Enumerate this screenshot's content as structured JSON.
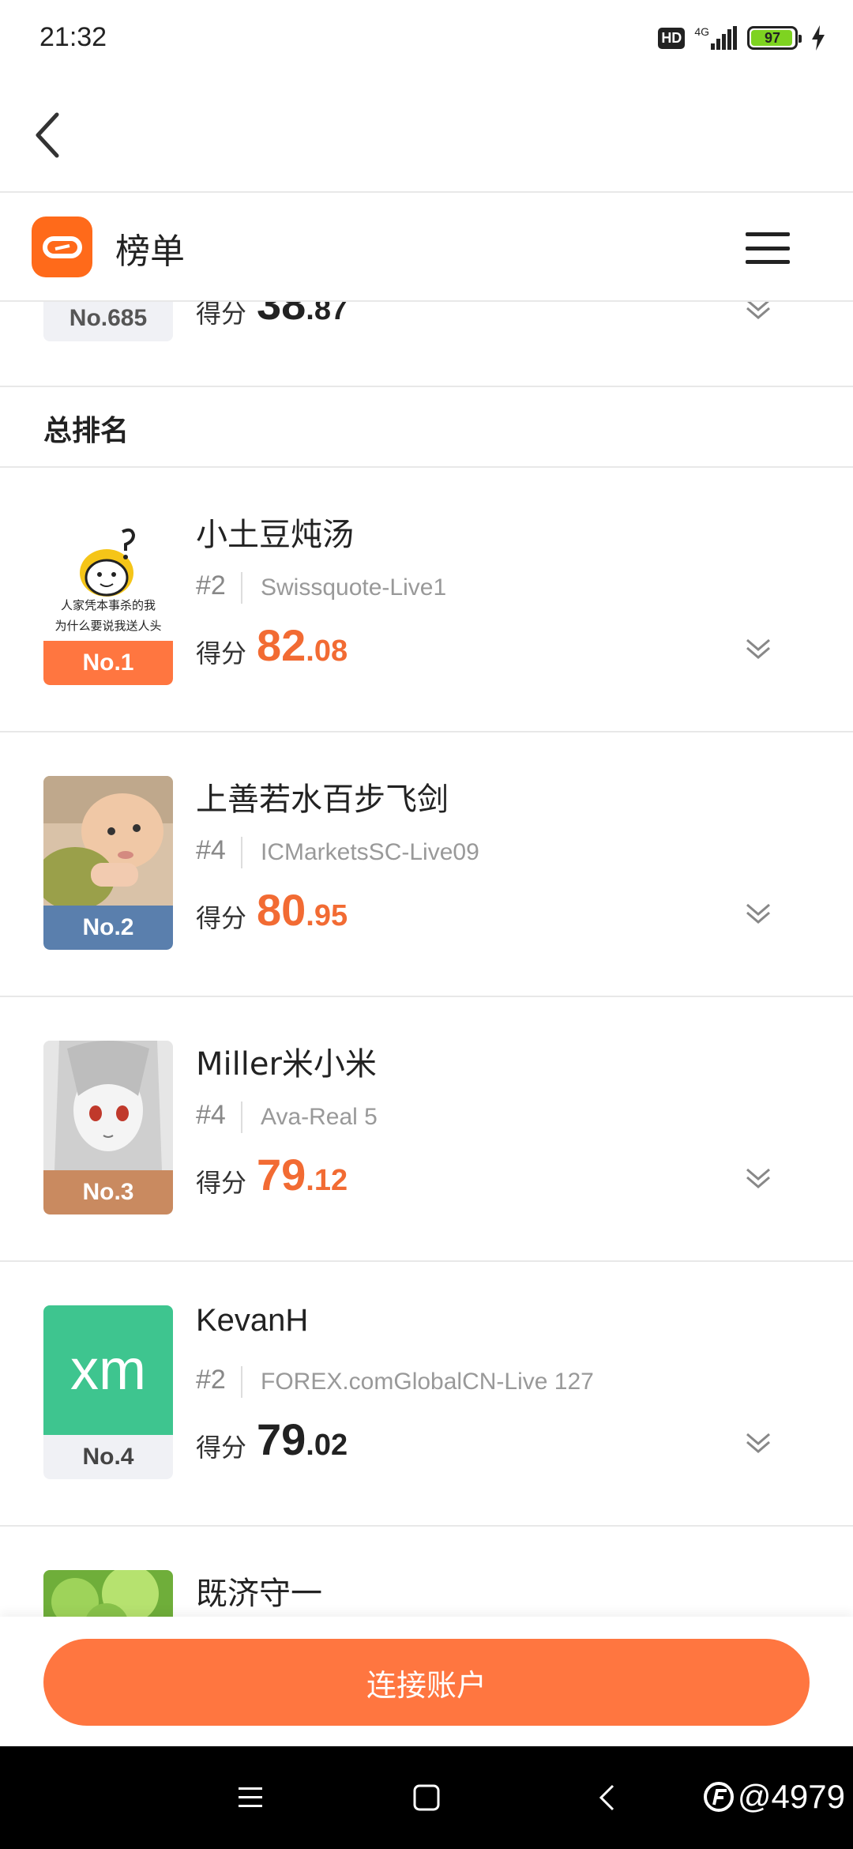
{
  "status_bar": {
    "time": "21:32",
    "hd_label": "HD",
    "network_label": "4G",
    "battery_level": "97",
    "battery_fraction": 0.97,
    "icons": [
      "hd-icon",
      "signal-icon",
      "battery-icon",
      "charging-icon"
    ]
  },
  "nav": {
    "back_icon": "chevron-left-icon"
  },
  "header": {
    "logo_icon": "app-logo-icon",
    "title": "榜单",
    "menu_icon": "hamburger-menu-icon"
  },
  "partial_item": {
    "rank": "No.685",
    "score_label": "得分",
    "score_int": "38",
    "score_dec": ".87"
  },
  "section": {
    "title": "总排名"
  },
  "rankings": [
    {
      "badge": "No.1",
      "name": "小土豆炖汤",
      "rank": "#2",
      "server": "Swissquote-Live1",
      "score_label": "得分",
      "score_int": "82",
      "score_dec": ".08",
      "avatar_text_1": "人家凭本事杀的我",
      "avatar_text_2": "为什么要说我送人头"
    },
    {
      "badge": "No.2",
      "name": "上善若水百步飞剑",
      "rank": "#4",
      "server": "ICMarketsSC-Live09",
      "score_label": "得分",
      "score_int": "80",
      "score_dec": ".95"
    },
    {
      "badge": "No.3",
      "name": "Miller米小米",
      "rank": "#4",
      "server": "Ava-Real 5",
      "score_label": "得分",
      "score_int": "79",
      "score_dec": ".12"
    },
    {
      "badge": "No.4",
      "name": "KevanH",
      "rank": "#2",
      "server": "FOREX.comGlobalCN-Live 127",
      "score_label": "得分",
      "score_int": "79",
      "score_dec": ".02",
      "avatar_text": "xm"
    },
    {
      "name": "既济守一"
    }
  ],
  "footer": {
    "connect_label": "连接账户"
  },
  "android_nav": {
    "watermark": "@4979"
  },
  "colors": {
    "accent": "#ff7640",
    "gold_badge": "#ff7640",
    "silver_badge": "#5a7fad",
    "bronze_badge": "#c98a60",
    "plain_badge": "#f0f1f5",
    "top_score": "#f26b33"
  }
}
